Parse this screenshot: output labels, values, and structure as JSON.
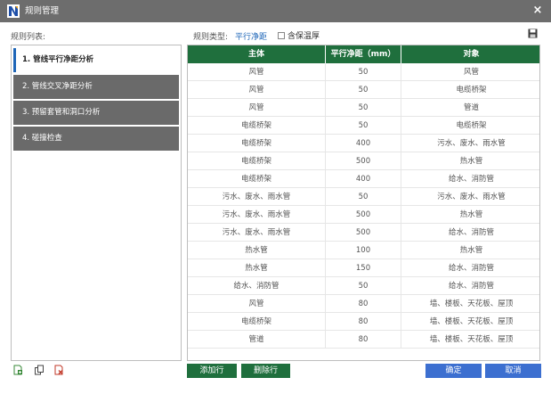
{
  "window": {
    "title": "规则管理",
    "close_label": "×"
  },
  "top": {
    "list_label": "规则列表:",
    "type_label": "规则类型:",
    "type_value": "平行净距",
    "checkbox_label": "含保温厚",
    "checkbox_checked": false
  },
  "rules": [
    {
      "label": "1. 管线平行净距分析",
      "active": true
    },
    {
      "label": "2. 管线交叉净距分析",
      "active": false
    },
    {
      "label": "3. 预留套管和洞口分析",
      "active": false
    },
    {
      "label": "4. 碰撞检查",
      "active": false
    }
  ],
  "table": {
    "headers": [
      "主体",
      "平行净距（mm）",
      "对象"
    ],
    "rows": [
      [
        "风管",
        "50",
        "风管"
      ],
      [
        "风管",
        "50",
        "电缆桥架"
      ],
      [
        "风管",
        "50",
        "管道"
      ],
      [
        "电缆桥架",
        "50",
        "电缆桥架"
      ],
      [
        "电缆桥架",
        "400",
        "污水、废水、雨水管"
      ],
      [
        "电缆桥架",
        "500",
        "热水管"
      ],
      [
        "电缆桥架",
        "400",
        "给水、消防管"
      ],
      [
        "污水、废水、雨水管",
        "50",
        "污水、废水、雨水管"
      ],
      [
        "污水、废水、雨水管",
        "500",
        "热水管"
      ],
      [
        "污水、废水、雨水管",
        "500",
        "给水、消防管"
      ],
      [
        "热水管",
        "100",
        "热水管"
      ],
      [
        "热水管",
        "150",
        "给水、消防管"
      ],
      [
        "给水、消防管",
        "50",
        "给水、消防管"
      ],
      [
        "风管",
        "80",
        "墙、楼板、天花板、屋顶"
      ],
      [
        "电缆桥架",
        "80",
        "墙、楼板、天花板、屋顶"
      ],
      [
        "管道",
        "80",
        "墙、楼板、天花板、屋顶"
      ]
    ]
  },
  "buttons": {
    "add_row": "添加行",
    "delete_row": "删除行",
    "ok": "确定",
    "cancel": "取消"
  },
  "icons": [
    "app-logo-icon",
    "close-icon",
    "save-icon",
    "add-rule-icon",
    "copy-rule-icon",
    "delete-rule-icon"
  ],
  "colors": {
    "titlebar": "#6d6d6d",
    "header_green": "#1f6f3d",
    "accent_blue": "#1e66b8",
    "button_blue": "#3c6fd0",
    "item_gray": "#6a6a6a"
  }
}
